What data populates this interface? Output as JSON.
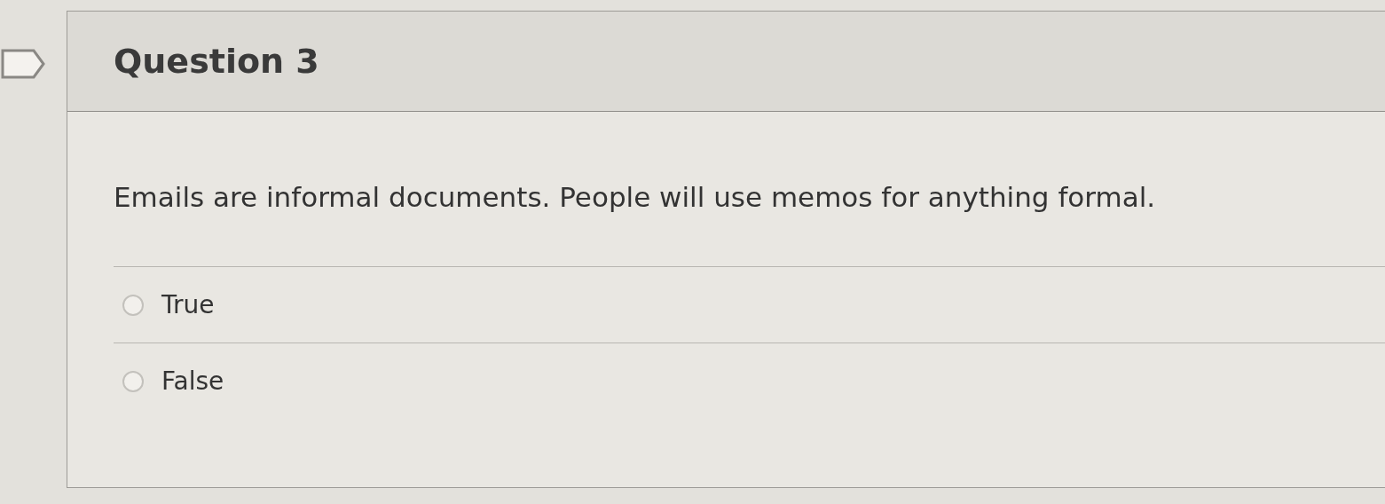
{
  "question": {
    "title": "Question 3",
    "flagged": false,
    "text": "Emails are informal documents. People will use memos for anything formal.",
    "options": [
      {
        "label": "True",
        "selected": false
      },
      {
        "label": "False",
        "selected": false
      }
    ]
  }
}
